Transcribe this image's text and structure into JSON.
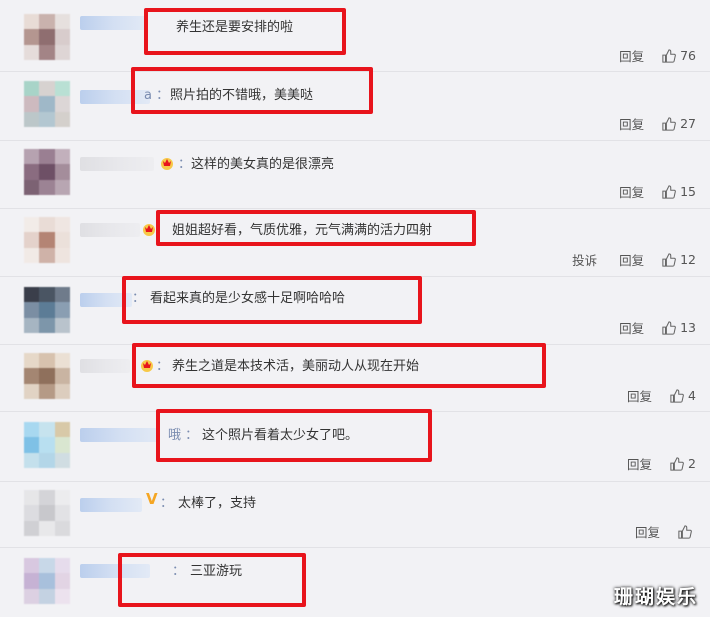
{
  "comments": [
    {
      "text": "养生还是要安排的啦",
      "prefix": "",
      "reply": "回复",
      "report": "",
      "likes": "76"
    },
    {
      "text": "照片拍的不错哦，美美哒",
      "prefix": "a ：",
      "reply": "回复",
      "report": "",
      "likes": "27"
    },
    {
      "text": "这样的美女真的是很漂亮",
      "prefix": "：",
      "reply": "回复",
      "report": "",
      "likes": "15"
    },
    {
      "text": "姐姐超好看，气质优雅，元气满满的活力四射",
      "prefix": "",
      "reply": "回复",
      "report": "投诉",
      "likes": "12"
    },
    {
      "text": "看起来真的是少女感十足啊哈哈哈",
      "prefix": "：",
      "reply": "回复",
      "report": "",
      "likes": "13"
    },
    {
      "text": "养生之道是本技术活，美丽动人从现在开始",
      "prefix": "：",
      "reply": "回复",
      "report": "",
      "likes": "4"
    },
    {
      "text": "这个照片看着太少女了吧。",
      "prefix": "哦 ：",
      "reply": "回复",
      "report": "",
      "likes": "2"
    },
    {
      "text": "太棒了，支持",
      "prefix": "：",
      "reply": "回复",
      "report": "",
      "likes": ""
    },
    {
      "text": "三亚游玩",
      "prefix": "：",
      "reply": "",
      "report": "",
      "likes": ""
    }
  ],
  "watermark": "珊瑚娱乐",
  "colors": {
    "highlight_box": "#e8141c",
    "background": "#f2f2f5",
    "vip_gold": "#f5a623"
  }
}
